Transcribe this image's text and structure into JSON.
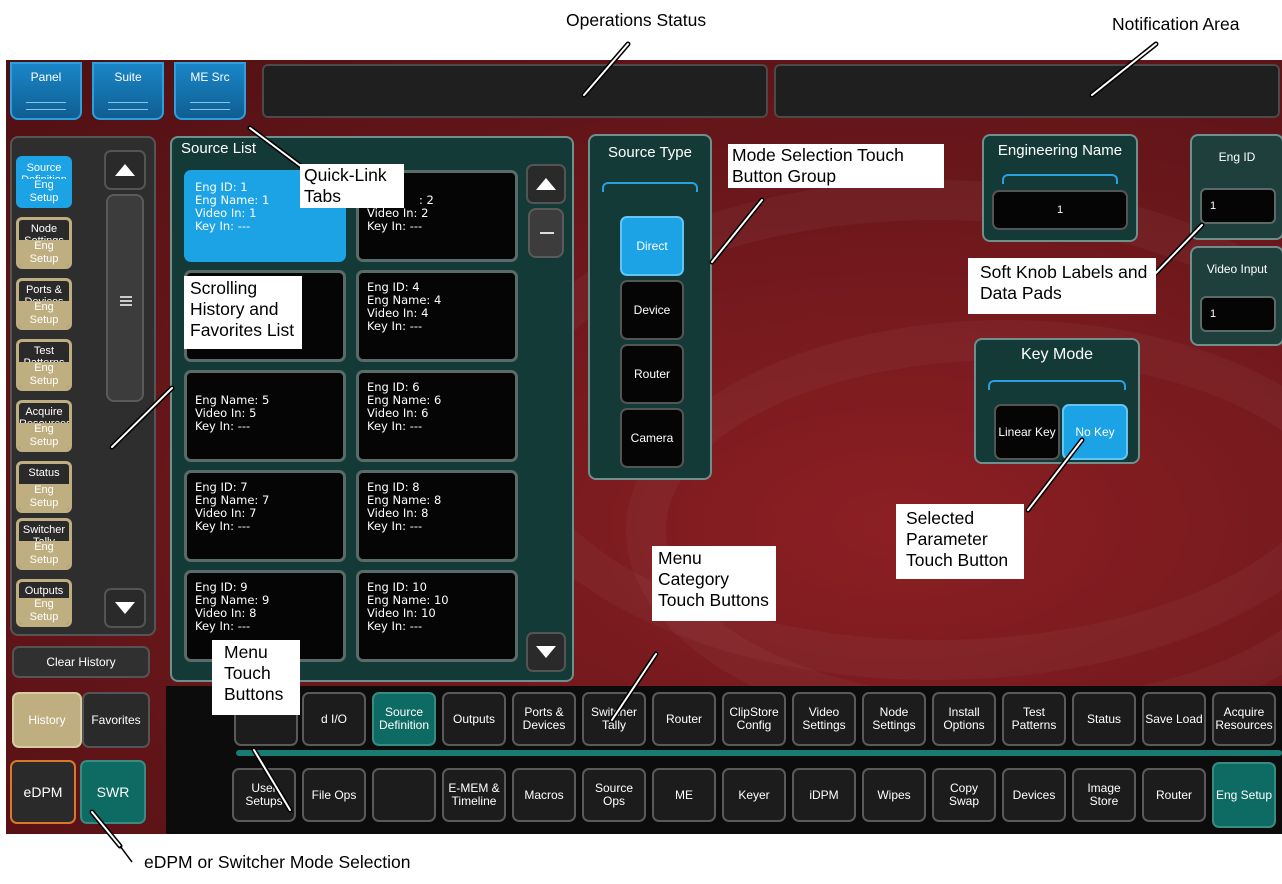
{
  "annotations": {
    "operations_status": "Operations Status",
    "notification_area": "Notification Area",
    "quick_link_tabs": "Quick-Link Tabs",
    "mode_selection": "Mode Selection Touch Button Group",
    "soft_knob": "Soft Knob Labels and Data Pads",
    "scrolling_history": "Scrolling History and Favorites List",
    "selected_parameter": "Selected Parameter Touch Button",
    "menu_category": "Menu Category Touch Buttons",
    "menu_touch": "Menu Touch Buttons",
    "edpm_mode": "eDPM or Switcher Mode Selection"
  },
  "quick_tabs": [
    "Panel",
    "Suite",
    "ME Src"
  ],
  "history": {
    "items": [
      {
        "label": "Source Definition",
        "sub": "Eng Setup",
        "selected": true
      },
      {
        "label": "Node Settings",
        "sub": "Eng Setup"
      },
      {
        "label": "Ports & Devices",
        "sub": "Eng Setup"
      },
      {
        "label": "Test Patterns",
        "sub": "Eng Setup"
      },
      {
        "label": "Acquire Resources",
        "sub": "Eng Setup"
      },
      {
        "label": "Status",
        "sub": "Eng Setup"
      },
      {
        "label": "Switcher Tally",
        "sub": "Eng Setup"
      },
      {
        "label": "Outputs",
        "sub": "Eng Setup"
      }
    ],
    "clear_label": "Clear History",
    "history_tab": "History",
    "favorites_tab": "Favorites"
  },
  "mode": {
    "edpm": "eDPM",
    "swr": "SWR"
  },
  "source_list": {
    "title": "Source List",
    "cells": [
      {
        "eng_id": "Eng ID: 1",
        "eng_name": "Eng Name: 1",
        "video_in": "Video In: 1",
        "key_in": "Key In: ---",
        "selected": true
      },
      {
        "eng_id": "",
        "eng_name": ": 2",
        "video_in": "Video In: 2",
        "key_in": "Key In: ---"
      },
      {
        "eng_id": "",
        "eng_name": "",
        "video_in": "",
        "key_in": ""
      },
      {
        "eng_id": "Eng ID: 4",
        "eng_name": "Eng Name: 4",
        "video_in": "Video In: 4",
        "key_in": "Key In: ---"
      },
      {
        "eng_id": "",
        "eng_name": "Eng Name: 5",
        "video_in": "Video In: 5",
        "key_in": "Key In: ---"
      },
      {
        "eng_id": "Eng ID: 6",
        "eng_name": "Eng Name: 6",
        "video_in": "Video In: 6",
        "key_in": "Key In: ---"
      },
      {
        "eng_id": "Eng ID: 7",
        "eng_name": "Eng Name: 7",
        "video_in": "Video In: 7",
        "key_in": "Key In: ---"
      },
      {
        "eng_id": "Eng ID: 8",
        "eng_name": "Eng Name: 8",
        "video_in": "Video In: 8",
        "key_in": "Key In: ---"
      },
      {
        "eng_id": "Eng ID: 9",
        "eng_name": "Eng Name: 9",
        "video_in": "Video In: 8",
        "key_in": "Key In: ---"
      },
      {
        "eng_id": "Eng ID: 10",
        "eng_name": "Eng Name: 10",
        "video_in": "Video In: 10",
        "key_in": "Key In: ---"
      }
    ]
  },
  "source_type": {
    "title": "Source Type",
    "options": [
      "Direct",
      "Device",
      "Router",
      "Camera"
    ],
    "selected": "Direct"
  },
  "engineering_name": {
    "title": "Engineering Name",
    "value": "1"
  },
  "key_mode": {
    "title": "Key Mode",
    "options": [
      "Linear Key",
      "No Key"
    ],
    "selected": "No Key"
  },
  "soft_knobs": [
    {
      "label": "Eng ID",
      "value": "1"
    },
    {
      "label": "Video Input",
      "value": "1"
    }
  ],
  "category_row": [
    "d I/O",
    "Source Definition",
    "Outputs",
    "Ports & Devices",
    "Switcher Tally",
    "Router",
    "ClipStore Config",
    "Video Settings",
    "Node Settings",
    "Install Options",
    "Test Patterns",
    "Status",
    "Save Load",
    "Acquire Resources"
  ],
  "category_active": "Source Definition",
  "menu_row": [
    "User Setups",
    "File Ops",
    "",
    "E-MEM & Timeline",
    "Macros",
    "Source Ops",
    "ME",
    "Keyer",
    "iDPM",
    "Wipes",
    "Copy Swap",
    "Devices",
    "Image Store",
    "Router",
    "Eng Setup"
  ],
  "menu_active": "Eng Setup",
  "colors": {
    "accent": "#1ba3e6",
    "teal": "#0e6b64",
    "tan": "#bfae80",
    "background": "#6f181c"
  }
}
